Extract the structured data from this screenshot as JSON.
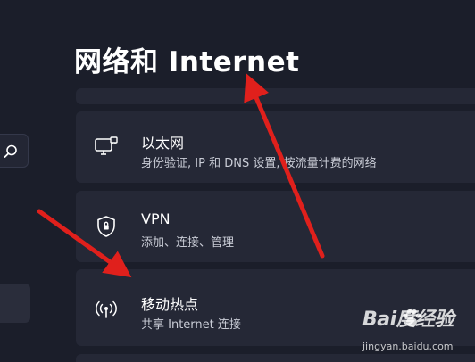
{
  "page": {
    "title": "网络和 Internet"
  },
  "cards": [
    {
      "title": "以太网",
      "subtitle": "身份验证, IP 和 DNS 设置, 按流量计费的网络",
      "icon": "ethernet-monitor-icon"
    },
    {
      "title": "VPN",
      "subtitle": "添加、连接、管理",
      "icon": "vpn-shield-icon"
    },
    {
      "title": "移动热点",
      "subtitle": "共享 Internet 连接",
      "icon": "mobile-hotspot-icon"
    }
  ],
  "sidebar": {
    "search_icon": "search-icon"
  },
  "watermark": {
    "logo": "Bai度经验",
    "url": "jingyan.baidu.com"
  },
  "colors": {
    "background": "#1b1e2a",
    "card": "#252836",
    "arrow": "#e0201c",
    "text": "#ffffff",
    "subtext": "#c9ccd6"
  }
}
